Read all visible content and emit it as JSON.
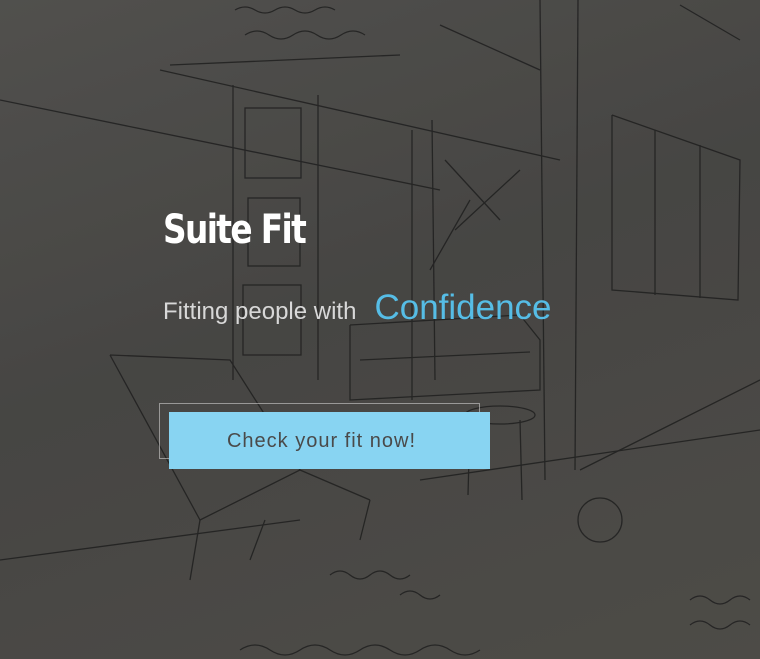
{
  "hero": {
    "title": "Suite Fit",
    "tagline_lead": "Fitting people with",
    "tagline_accent": "Confidence",
    "cta_label": "Check your fit now!"
  },
  "colors": {
    "accent_text": "#56bde6",
    "cta_background": "#88d4f2",
    "title_text": "#ffffff"
  },
  "background": {
    "image": "pencil-sketch-interior-lounge"
  }
}
